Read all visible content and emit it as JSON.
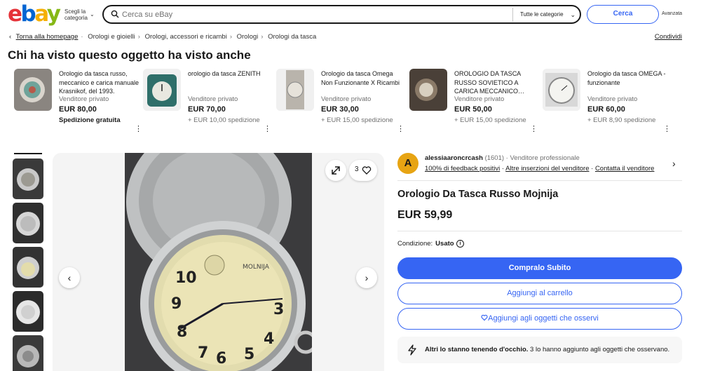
{
  "header": {
    "logo_letters": [
      "e",
      "b",
      "a",
      "y"
    ],
    "shop_by_category": "Scegli la categoria",
    "search_placeholder": "Cerca su eBay",
    "category_select": "Tutte le categorie",
    "search_button": "Cerca",
    "advanced": "Avanzata"
  },
  "breadcrumb": {
    "items": [
      "Torna alla homepage",
      "Orologi e gioielli",
      "Orologi, accessori e ricambi",
      "Orologi",
      "Orologi da tasca"
    ],
    "share": "Condividi"
  },
  "also_viewed": {
    "title": "Chi ha visto questo oggetto ha visto anche",
    "cards": [
      {
        "title": "Orologio da tasca russo, meccanico e carica manuale Krasnikof, del 1993.",
        "seller": "Venditore privato",
        "price": "EUR 80,00",
        "shipping": "Spedizione gratuita",
        "free": true
      },
      {
        "title": "orologio da tasca ZENITH",
        "seller": "Venditore privato",
        "price": "EUR 70,00",
        "shipping": "+ EUR 10,00 spedizione",
        "free": false
      },
      {
        "title": "Orologio da tasca Omega Non Funzionante X Ricambi",
        "seller": "Venditore privato",
        "price": "EUR 30,00",
        "shipping": "+ EUR 15,00 spedizione",
        "free": false
      },
      {
        "title": "OROLOGIO DA TASCA RUSSO SOVIETICO A CARICA MECCANICO…",
        "seller": "Venditore privato",
        "price": "EUR 50,00",
        "shipping": "+ EUR 15,00 spedizione",
        "free": false
      },
      {
        "title": "Orologio da tasca OMEGA - funzionante",
        "seller": "Venditore privato",
        "price": "EUR 60,00",
        "shipping": "+ EUR 8,90 spedizione",
        "free": false
      }
    ]
  },
  "gallery": {
    "watch_count": "3",
    "dial_brand": "MOLNIJA"
  },
  "seller": {
    "avatar_letter": "A",
    "name": "alessiaaroncrcash",
    "feedback_count": "(1601)",
    "type": "Venditore professionale",
    "feedback_positive": "100% di feedback positivi",
    "other_listings": "Altre inserzioni del venditore",
    "contact": "Contatta il venditore"
  },
  "item": {
    "title": "Orologio Da Tasca Russo Mojnija",
    "price": "EUR 59,99",
    "condition_label": "Condizione:",
    "condition_value": "Usato"
  },
  "actions": {
    "buy_now": "Compralo Subito",
    "add_to_cart": "Aggiungi al carrello",
    "add_to_watchlist": "Aggiungi agli oggetti che osservi"
  },
  "signal": {
    "bold": "Altri lo stanno tenendo d'occhio.",
    "text": "3 lo hanno aggiunto agli oggetti che osservano."
  },
  "colors": {
    "primary": "#3665f3",
    "text": "#191919",
    "muted": "#707070"
  }
}
